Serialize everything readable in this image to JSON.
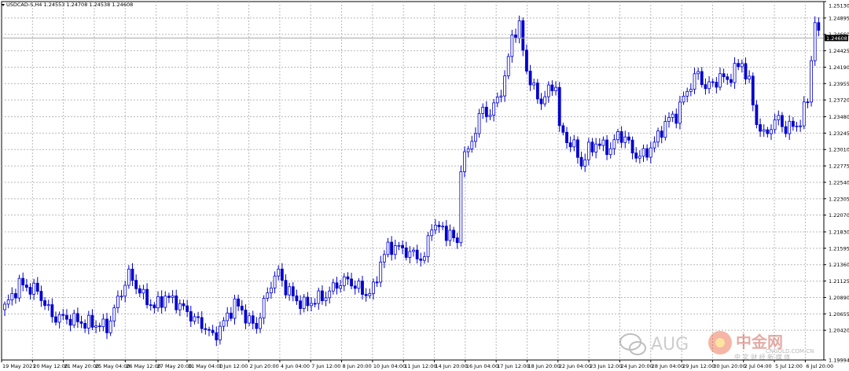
{
  "chart_data": {
    "type": "candlestick",
    "title": "USDCAD-S,H4 1.24553 1.24708 1.24538 1.24608",
    "current_price": 1.24608,
    "current_price_label": "1.24608",
    "ylim": [
      1.19994,
      1.2513
    ],
    "y_ticks": [
      1.2513,
      1.24895,
      1.2466,
      1.24425,
      1.2419,
      1.23955,
      1.2372,
      1.2348,
      1.23245,
      1.2301,
      1.22775,
      1.2254,
      1.22305,
      1.2207,
      1.2183,
      1.21595,
      1.2136,
      1.21125,
      1.2089,
      1.20655,
      1.2042,
      1.19994
    ],
    "y_tick_labels": [
      "1.25130",
      "1.24895",
      "1.24660",
      "1.24425",
      "1.24190",
      "1.23955",
      "1.23720",
      "1.23480",
      "1.23245",
      "1.23010",
      "1.22775",
      "1.22540",
      "1.22305",
      "1.22070",
      "1.21830",
      "1.21595",
      "1.21360",
      "1.21125",
      "1.20890",
      "1.20655",
      "1.20420",
      "1.19994"
    ],
    "x_tick_labels": [
      "19 May 2021",
      "20 May 12:00",
      "21 May 20:00",
      "25 May 04:00",
      "26 May 12:00",
      "27 May 20:00",
      "31 May 04:00",
      "1 Jun 12:00",
      "2 Jun 20:00",
      "4 Jun 04:00",
      "7 Jun 12:00",
      "8 Jun 20:00",
      "10 Jun 04:00",
      "11 Jun 12:00",
      "14 Jun 20:00",
      "16 Jun 04:00",
      "17 Jun 12:00",
      "18 Jun 20:00",
      "22 Jun 04:00",
      "23 Jun 12:00",
      "24 Jun 20:00",
      "28 Jun 04:00",
      "29 Jun 12:00",
      "30 Jun 20:00",
      "2 Jul 04:00",
      "5 Jul 12:00",
      "6 Jul 20:00"
    ],
    "anchors": [
      [
        0,
        1.2075
      ],
      [
        4,
        1.2108
      ],
      [
        9,
        1.2098
      ],
      [
        13,
        1.2062
      ],
      [
        18,
        1.2058
      ],
      [
        22,
        1.2052
      ],
      [
        26,
        1.205
      ],
      [
        28,
        1.2045
      ],
      [
        31,
        1.2085
      ],
      [
        34,
        1.2122
      ],
      [
        38,
        1.209
      ],
      [
        41,
        1.2075
      ],
      [
        44,
        1.209
      ],
      [
        47,
        1.2082
      ],
      [
        50,
        1.2068
      ],
      [
        52,
        1.2058
      ],
      [
        55,
        1.2046
      ],
      [
        57,
        1.2032
      ],
      [
        59,
        1.2045
      ],
      [
        61,
        1.2062
      ],
      [
        63,
        1.208
      ],
      [
        65,
        1.207
      ],
      [
        67,
        1.2054
      ],
      [
        69,
        1.2048
      ],
      [
        71,
        1.208
      ],
      [
        73,
        1.211
      ],
      [
        75,
        1.2125
      ],
      [
        77,
        1.2102
      ],
      [
        80,
        1.2085
      ],
      [
        82,
        1.2078
      ],
      [
        85,
        1.2085
      ],
      [
        88,
        1.2092
      ],
      [
        91,
        1.2108
      ],
      [
        94,
        1.2114
      ],
      [
        97,
        1.2102
      ],
      [
        99,
        1.2094
      ],
      [
        101,
        1.21
      ],
      [
        103,
        1.214
      ],
      [
        105,
        1.216
      ],
      [
        107,
        1.2162
      ],
      [
        110,
        1.2155
      ],
      [
        113,
        1.2148
      ],
      [
        115,
        1.2145
      ],
      [
        117,
        1.2195
      ],
      [
        120,
        1.2185
      ],
      [
        122,
        1.218
      ],
      [
        124,
        1.2165
      ],
      [
        125,
        1.228
      ],
      [
        127,
        1.23
      ],
      [
        129,
        1.233
      ],
      [
        131,
        1.236
      ],
      [
        133,
        1.235
      ],
      [
        135,
        1.2375
      ],
      [
        137,
        1.24
      ],
      [
        139,
        1.2465
      ],
      [
        141,
        1.2475
      ],
      [
        143,
        1.2415
      ],
      [
        145,
        1.2385
      ],
      [
        147,
        1.237
      ],
      [
        149,
        1.2385
      ],
      [
        151,
        1.2395
      ],
      [
        152,
        1.233
      ],
      [
        154,
        1.2315
      ],
      [
        156,
        1.2305
      ],
      [
        158,
        1.228
      ],
      [
        160,
        1.23
      ],
      [
        162,
        1.231
      ],
      [
        164,
        1.2305
      ],
      [
        166,
        1.2302
      ],
      [
        168,
        1.2322
      ],
      [
        170,
        1.2318
      ],
      [
        172,
        1.2298
      ],
      [
        174,
        1.229
      ],
      [
        176,
        1.2298
      ],
      [
        178,
        1.231
      ],
      [
        180,
        1.233
      ],
      [
        182,
        1.2345
      ],
      [
        184,
        1.235
      ],
      [
        186,
        1.2375
      ],
      [
        188,
        1.2395
      ],
      [
        190,
        1.241
      ],
      [
        192,
        1.239
      ],
      [
        194,
        1.2395
      ],
      [
        196,
        1.2405
      ],
      [
        198,
        1.24
      ],
      [
        200,
        1.2415
      ],
      [
        202,
        1.2425
      ],
      [
        204,
        1.2395
      ],
      [
        206,
        1.234
      ],
      [
        208,
        1.232
      ],
      [
        210,
        1.2335
      ],
      [
        212,
        1.2345
      ],
      [
        214,
        1.233
      ],
      [
        216,
        1.2335
      ],
      [
        218,
        1.234
      ],
      [
        220,
        1.2375
      ],
      [
        222,
        1.2485
      ],
      [
        223,
        1.2461
      ]
    ],
    "bar_count": 224,
    "grid": true,
    "bull_color": "#ffffff",
    "bear_color": "#0000cc",
    "wick_color": "#0000cc",
    "grid_color": "#b9b9b9",
    "price_line_color": "#a8a8a8"
  },
  "watermark": {
    "brand": "AUG",
    "name": "中金网",
    "domain": "CNGOLD.COM.CN",
    "subtitle": "中 文 财 经 新 媒 体"
  }
}
